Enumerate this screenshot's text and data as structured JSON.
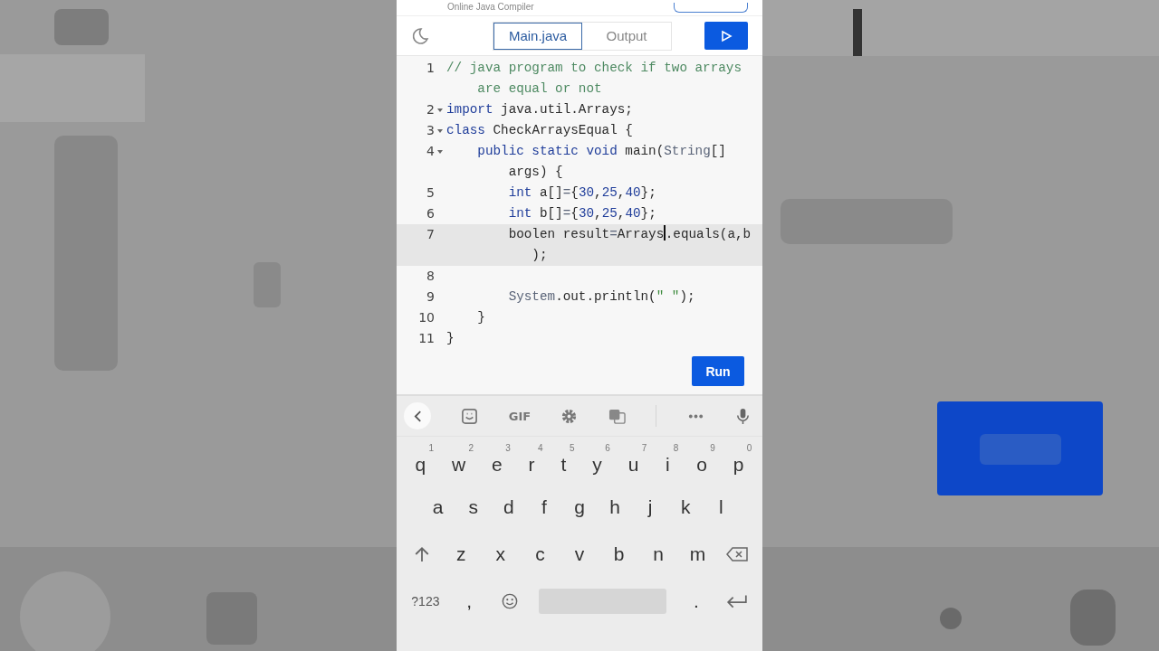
{
  "header": {
    "title": "Online Java Compiler"
  },
  "toolbar": {
    "tabs": [
      {
        "label": "Main.java",
        "selected": true
      },
      {
        "label": "Output",
        "selected": false
      }
    ]
  },
  "code": {
    "lines": [
      {
        "number": "1",
        "fold": false,
        "active": false,
        "rows": [
          [
            {
              "t": "// java program to check if two arrays",
              "kind": "comment"
            }
          ],
          [
            {
              "t": "    are equal or not",
              "kind": "comment"
            }
          ]
        ]
      },
      {
        "number": "2",
        "fold": true,
        "active": false,
        "rows": [
          [
            {
              "t": "import",
              "kind": "keyword"
            },
            {
              "t": " java.util.Arrays;",
              "kind": "plain"
            }
          ]
        ]
      },
      {
        "number": "3",
        "fold": true,
        "active": false,
        "rows": [
          [
            {
              "t": "class",
              "kind": "keyword"
            },
            {
              "t": " CheckArraysEqual {",
              "kind": "plain"
            }
          ]
        ]
      },
      {
        "number": "4",
        "fold": true,
        "active": false,
        "rows": [
          [
            {
              "t": "    public static void",
              "kind": "keyword"
            },
            {
              "t": " main(",
              "kind": "plain"
            },
            {
              "t": "String",
              "kind": "type"
            },
            {
              "t": "[]",
              "kind": "plain"
            }
          ],
          [
            {
              "t": "        args) {",
              "kind": "plain"
            }
          ]
        ]
      },
      {
        "number": "5",
        "fold": false,
        "active": false,
        "rows": [
          [
            {
              "t": "        int",
              "kind": "keyword"
            },
            {
              "t": " a[]",
              "kind": "plain"
            },
            {
              "t": "=",
              "kind": "type"
            },
            {
              "t": "{",
              "kind": "plain"
            },
            {
              "t": "30",
              "kind": "number"
            },
            {
              "t": ",",
              "kind": "plain"
            },
            {
              "t": "25",
              "kind": "number"
            },
            {
              "t": ",",
              "kind": "plain"
            },
            {
              "t": "40",
              "kind": "number"
            },
            {
              "t": "};",
              "kind": "plain"
            }
          ]
        ]
      },
      {
        "number": "6",
        "fold": false,
        "active": false,
        "rows": [
          [
            {
              "t": "        int",
              "kind": "keyword"
            },
            {
              "t": " b[]",
              "kind": "plain"
            },
            {
              "t": "=",
              "kind": "type"
            },
            {
              "t": "{",
              "kind": "plain"
            },
            {
              "t": "30",
              "kind": "number"
            },
            {
              "t": ",",
              "kind": "plain"
            },
            {
              "t": "25",
              "kind": "number"
            },
            {
              "t": ",",
              "kind": "plain"
            },
            {
              "t": "40",
              "kind": "number"
            },
            {
              "t": "};",
              "kind": "plain"
            }
          ]
        ]
      },
      {
        "number": "7",
        "fold": false,
        "active": true,
        "rows": [
          [
            {
              "t": "        boolen result",
              "kind": "plain"
            },
            {
              "t": "=",
              "kind": "type"
            },
            {
              "t": "Arrays",
              "kind": "plain",
              "cursor": true
            },
            {
              "t": ".equals(a,b",
              "kind": "plain"
            }
          ],
          [
            {
              "t": "           );",
              "kind": "plain"
            }
          ]
        ]
      },
      {
        "number": "8",
        "fold": false,
        "active": false,
        "rows": [
          []
        ]
      },
      {
        "number": "9",
        "fold": false,
        "active": false,
        "rows": [
          [
            {
              "t": "        System",
              "kind": "type"
            },
            {
              "t": ".out.println(",
              "kind": "plain"
            },
            {
              "t": "\" \"",
              "kind": "string"
            },
            {
              "t": ");",
              "kind": "plain"
            }
          ]
        ]
      },
      {
        "number": "10",
        "fold": false,
        "active": false,
        "rows": [
          [
            {
              "t": "    }",
              "kind": "plain"
            }
          ]
        ]
      },
      {
        "number": "11",
        "fold": false,
        "active": false,
        "rows": [
          [
            {
              "t": "}",
              "kind": "plain"
            }
          ]
        ]
      }
    ],
    "run_label": "Run"
  },
  "keyboard": {
    "toolbar": [
      {
        "kind": "back"
      },
      {
        "kind": "sticker"
      },
      {
        "kind": "gif",
        "label": "GIF"
      },
      {
        "kind": "settings"
      },
      {
        "kind": "translate"
      },
      {
        "kind": "more"
      },
      {
        "kind": "mic"
      }
    ],
    "rows": [
      [
        {
          "kind": "letter",
          "label": "q",
          "hint": "1"
        },
        {
          "kind": "letter",
          "label": "w",
          "hint": "2"
        },
        {
          "kind": "letter",
          "label": "e",
          "hint": "3"
        },
        {
          "kind": "letter",
          "label": "r",
          "hint": "4"
        },
        {
          "kind": "letter",
          "label": "t",
          "hint": "5"
        },
        {
          "kind": "letter",
          "label": "y",
          "hint": "6"
        },
        {
          "kind": "letter",
          "label": "u",
          "hint": "7"
        },
        {
          "kind": "letter",
          "label": "i",
          "hint": "8"
        },
        {
          "kind": "letter",
          "label": "o",
          "hint": "9"
        },
        {
          "kind": "letter",
          "label": "p",
          "hint": "0"
        }
      ],
      [
        {
          "kind": "letter",
          "label": "a"
        },
        {
          "kind": "letter",
          "label": "s"
        },
        {
          "kind": "letter",
          "label": "d"
        },
        {
          "kind": "letter",
          "label": "f"
        },
        {
          "kind": "letter",
          "label": "g"
        },
        {
          "kind": "letter",
          "label": "h"
        },
        {
          "kind": "letter",
          "label": "j"
        },
        {
          "kind": "letter",
          "label": "k"
        },
        {
          "kind": "letter",
          "label": "l"
        }
      ],
      [
        {
          "kind": "shift"
        },
        {
          "kind": "letter",
          "label": "z"
        },
        {
          "kind": "letter",
          "label": "x"
        },
        {
          "kind": "letter",
          "label": "c"
        },
        {
          "kind": "letter",
          "label": "v"
        },
        {
          "kind": "letter",
          "label": "b"
        },
        {
          "kind": "letter",
          "label": "n"
        },
        {
          "kind": "letter",
          "label": "m"
        },
        {
          "kind": "backspace"
        }
      ],
      [
        {
          "kind": "small",
          "label": "?123"
        },
        {
          "kind": "letter",
          "label": ","
        },
        {
          "kind": "emoji"
        },
        {
          "kind": "space"
        },
        {
          "kind": "letter",
          "label": "."
        },
        {
          "kind": "enter"
        }
      ]
    ]
  }
}
